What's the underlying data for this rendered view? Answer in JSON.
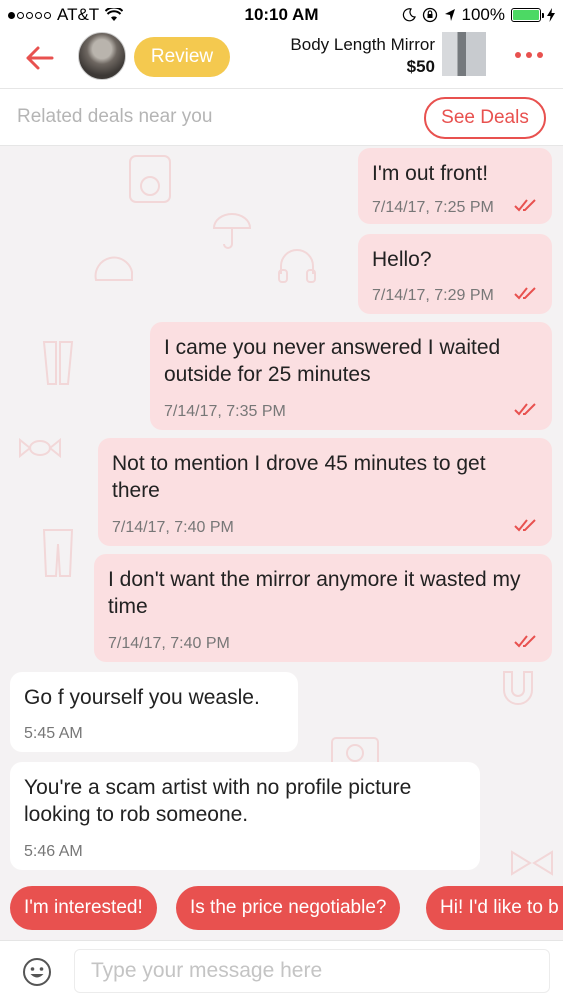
{
  "status_bar": {
    "carrier": "AT&T",
    "time": "10:10 AM",
    "battery": "100%",
    "battery_level": 1.0
  },
  "header": {
    "review_label": "Review",
    "item_title": "Body Length Mirror",
    "item_price": "$50"
  },
  "deals": {
    "text": "Related deals near you",
    "button_label": "See Deals"
  },
  "messages": [
    {
      "direction": "out",
      "text": "I'm out front!",
      "time": "7/14/17, 7:25 PM",
      "read": true
    },
    {
      "direction": "out",
      "text": "Hello?",
      "time": "7/14/17, 7:29 PM",
      "read": true
    },
    {
      "direction": "out",
      "text": "I came you never answered I waited outside for 25 minutes",
      "time": "7/14/17, 7:35 PM",
      "read": true
    },
    {
      "direction": "out",
      "text": "Not to mention I drove 45 minutes to get there",
      "time": "7/14/17, 7:40 PM",
      "read": true
    },
    {
      "direction": "out",
      "text": "I don't want the mirror anymore it wasted my time",
      "time": "7/14/17, 7:40 PM",
      "read": true
    },
    {
      "direction": "in",
      "text": "Go f yourself you weasle.",
      "time": "5:45 AM"
    },
    {
      "direction": "in",
      "text": "You're a scam artist with no profile picture looking to rob someone.",
      "time": "5:46 AM"
    }
  ],
  "quick_replies": [
    "I'm interested!",
    "Is the price negotiable?",
    "Hi! I'd like to b"
  ],
  "composer": {
    "placeholder": "Type your message here"
  },
  "colors": {
    "accent": "#e8514f",
    "review_badge": "#f4c94f",
    "outgoing_bubble": "#fbdfe1",
    "incoming_bubble": "#ffffff",
    "background": "#f4f2f3"
  },
  "icons": {
    "back": "back-arrow-icon",
    "more": "more-dots-icon",
    "read_receipt": "double-check-icon",
    "emoji": "emoji-icon",
    "wifi": "wifi-icon",
    "location": "location-arrow-icon",
    "alarm": "rotation-lock-icon",
    "moon": "moon-icon",
    "charging": "charging-bolt-icon"
  }
}
